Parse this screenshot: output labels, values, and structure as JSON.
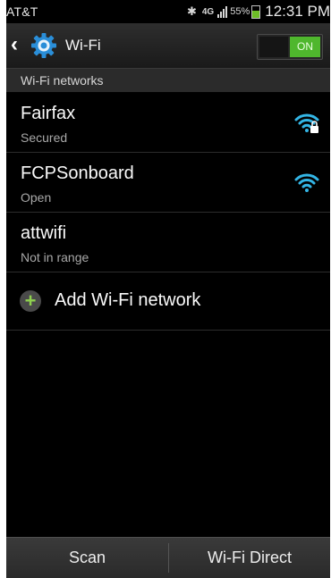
{
  "status_bar": {
    "carrier": "AT&T",
    "battery_percent": "55%",
    "battery_level": 0.55,
    "time": "12:31 PM",
    "icons": [
      "bluetooth-icon",
      "lte-icon",
      "signal-icon",
      "battery-icon"
    ]
  },
  "action_bar": {
    "title": "Wi-Fi",
    "toggle_label": "ON",
    "toggle_state": "on"
  },
  "section_header": "Wi-Fi networks",
  "networks": [
    {
      "name": "Fairfax",
      "status": "Secured",
      "icon": "wifi-lock-icon"
    },
    {
      "name": "FCPSonboard",
      "status": "Open",
      "icon": "wifi-icon"
    },
    {
      "name": "attwifi",
      "status": "Not in range",
      "icon": ""
    }
  ],
  "add_network": {
    "label": "Add Wi-Fi network"
  },
  "bottom_bar": {
    "scan": "Scan",
    "wifi_direct": "Wi-Fi Direct"
  },
  "colors": {
    "accent": "#4fb72d",
    "wifi_icon": "#33b5e5",
    "background": "#000000"
  }
}
